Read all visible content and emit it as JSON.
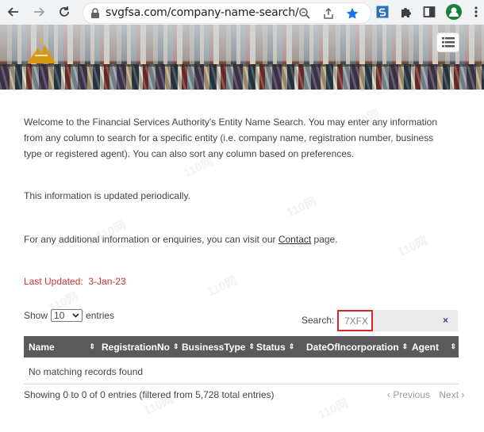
{
  "browser": {
    "url": "svgfsa.com/company-name-search/"
  },
  "content": {
    "intro": "Welcome to the Financial Services Authority's Entity Name Search. You may enter any information from any column to search for a specific entity (i.e. company name, registration number, business type or registered agent). You can also sort any column based on preferences.",
    "updated_note": "This information is updated periodically.",
    "contact_prefix": "For any additional information or enquiries, you can visit our ",
    "contact_link": "Contact",
    "contact_suffix": " page.",
    "last_updated_label": "Last Updated:",
    "last_updated_date": "3-Jan-23"
  },
  "table_controls": {
    "show_label": "Show",
    "entries_value": "10",
    "entries_label": "entries",
    "search_label": "Search:",
    "search_value": "7XFX",
    "clear_label": "×"
  },
  "table": {
    "columns": [
      "Name",
      "RegistrationNo",
      "BusinessType",
      "Status",
      "DateOfIncorporation",
      "Agent"
    ],
    "sort_glyph": "⇕",
    "empty_message": "No matching records found",
    "info": "Showing 0 to 0 of 0 entries (filtered from 5,728 total entries)",
    "previous": "Previous",
    "next": "Next"
  },
  "watermark_text": "110网",
  "colors": {
    "accent_red": "#cc3333",
    "header_bg": "#5a5a5a",
    "highlight": "#d9282d",
    "chrome_blue": "#1a73e8"
  },
  "icons": [
    "back-arrow-icon",
    "forward-arrow-icon",
    "reload-icon",
    "lock-icon",
    "zoom-icon",
    "share-icon",
    "bookmark-star-icon",
    "extension-s-icon",
    "puzzle-icon",
    "side-panel-icon",
    "profile-icon",
    "more-vert-icon",
    "hamburger-menu-icon"
  ]
}
